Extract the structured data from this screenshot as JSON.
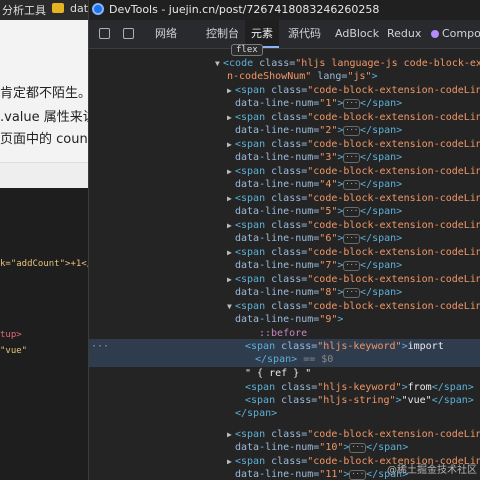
{
  "background_window": {
    "tab_label": "分析工具",
    "tab2_label": "dat",
    "article_lines": [
      "肯定都不陌生。",
      ".value 属性来访",
      "页面中的 coun"
    ],
    "code_lines": [
      {
        "text": "k=\"addCount\">+1</",
        "color": "#e8c27a"
      },
      {
        "text": "tup>",
        "color": "#e06c75"
      },
      {
        "text": "\"vue\"",
        "color": "#e8c27a"
      }
    ]
  },
  "devtools": {
    "title": "DevTools - juejin.cn/post/7267418083246260258",
    "tabs": [
      "网络",
      "控制台",
      "元素",
      "源代码",
      "AdBlock",
      "Redux",
      "Compon"
    ],
    "active_tab": "元素",
    "flex_badge": "flex",
    "code_open": {
      "tag": "code",
      "class_attr": "class=",
      "class_val": "\"hljs language-js code-block-extens",
      "class_val_cont": "n-codeShowNum\"",
      "lang_attr": "lang=",
      "lang_val": "\"js\""
    },
    "span_class_val": "\"code-block-extension-codeLine\"",
    "line_attr": "data-line-num=",
    "line_nums": [
      "\"1\"",
      "\"2\"",
      "\"3\"",
      "\"4\"",
      "\"5\"",
      "\"6\"",
      "\"7\"",
      "\"8\"",
      "\"9\"",
      "\"10\"",
      "\"11\""
    ],
    "pseudo": "::before",
    "keyword_class": "\"hljs-keyword\"",
    "string_class": "\"hljs-string\"",
    "text_import": "import",
    "text_ref": "\" { ref } \"",
    "text_from": "from",
    "text_vue": "\"vue\"",
    "selected_marker": "== $0",
    "dots": "···"
  },
  "watermark": "@稀土掘金技术社区"
}
